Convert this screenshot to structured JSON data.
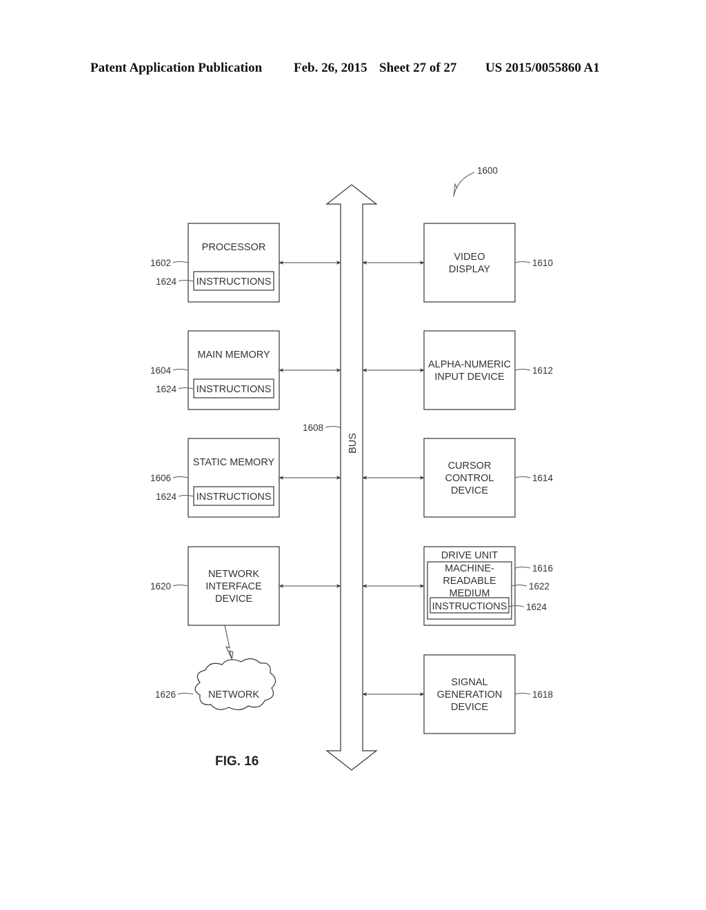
{
  "header": {
    "publication": "Patent Application Publication",
    "date": "Feb. 26, 2015",
    "sheet": "Sheet 27 of 27",
    "number": "US 2015/0055860 A1"
  },
  "figure": {
    "label": "FIG. 16",
    "system_ref": "1600",
    "bus": {
      "label": "BUS",
      "ref": "1608"
    },
    "left_blocks": [
      {
        "id": "processor",
        "lines": [
          "PROCESSOR"
        ],
        "ref": "1602",
        "inner": {
          "label": "INSTRUCTIONS",
          "ref": "1624"
        }
      },
      {
        "id": "main-memory",
        "lines": [
          "MAIN MEMORY"
        ],
        "ref": "1604",
        "inner": {
          "label": "INSTRUCTIONS",
          "ref": "1624"
        }
      },
      {
        "id": "static-memory",
        "lines": [
          "STATIC MEMORY"
        ],
        "ref": "1606",
        "inner": {
          "label": "INSTRUCTIONS",
          "ref": "1624"
        }
      },
      {
        "id": "network-interface-device",
        "lines": [
          "NETWORK",
          "INTERFACE",
          "DEVICE"
        ],
        "ref": "1620"
      }
    ],
    "right_blocks": [
      {
        "id": "video-display",
        "lines": [
          "VIDEO",
          "DISPLAY"
        ],
        "ref": "1610"
      },
      {
        "id": "alpha-numeric-input-device",
        "lines": [
          "ALPHA-NUMERIC",
          "INPUT DEVICE"
        ],
        "ref": "1612"
      },
      {
        "id": "cursor-control-device",
        "lines": [
          "CURSOR",
          "CONTROL",
          "DEVICE"
        ],
        "ref": "1614"
      },
      {
        "id": "drive-unit",
        "lines": [
          "DRIVE UNIT"
        ],
        "ref": "1616",
        "medium": {
          "lines": [
            "MACHINE-",
            "READABLE",
            "MEDIUM"
          ],
          "ref": "1622"
        },
        "inner": {
          "label": "INSTRUCTIONS",
          "ref": "1624"
        }
      },
      {
        "id": "signal-generation-device",
        "lines": [
          "SIGNAL",
          "GENERATION",
          "DEVICE"
        ],
        "ref": "1618"
      }
    ],
    "network": {
      "label": "NETWORK",
      "ref": "1626"
    }
  }
}
